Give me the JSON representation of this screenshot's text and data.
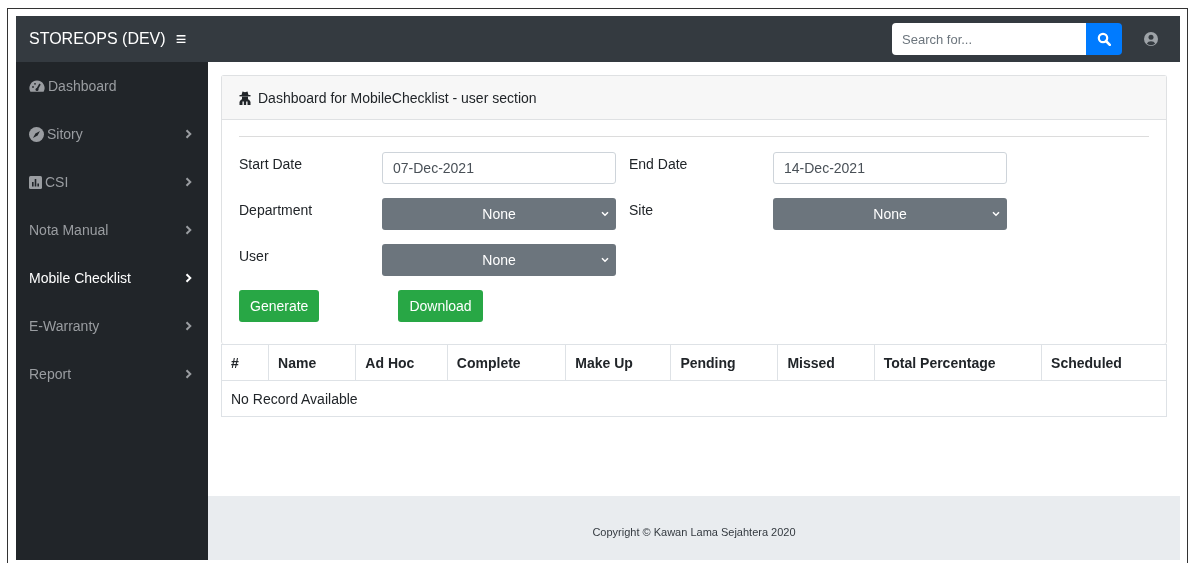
{
  "header": {
    "brand": "STOREOPS (DEV)",
    "menu_icon": "≡",
    "search": {
      "placeholder": "Search for..."
    }
  },
  "sidebar": {
    "items": [
      {
        "label": "Dashboard",
        "has_icon": true,
        "has_submenu": false,
        "selected": false
      },
      {
        "label": "Sitory",
        "has_icon": true,
        "has_submenu": true,
        "selected": false
      },
      {
        "label": "CSI",
        "has_icon": true,
        "has_submenu": true,
        "selected": false
      },
      {
        "label": "Nota Manual",
        "has_icon": false,
        "has_submenu": true,
        "selected": false
      },
      {
        "label": "Mobile Checklist",
        "has_icon": false,
        "has_submenu": true,
        "selected": true
      },
      {
        "label": "E-Warranty",
        "has_icon": false,
        "has_submenu": true,
        "selected": false
      },
      {
        "label": "Report",
        "has_icon": false,
        "has_submenu": true,
        "selected": false
      }
    ]
  },
  "card": {
    "title": "Dashboard for MobileChecklist - user section",
    "fields": [
      {
        "kind": "date",
        "label": "Start Date",
        "value": "07-Dec-2021"
      },
      {
        "kind": "date",
        "label": "End Date",
        "value": "14-Dec-2021"
      },
      {
        "kind": "select",
        "label": "Department",
        "value": "None"
      },
      {
        "kind": "select",
        "label": "Site",
        "value": "None"
      },
      {
        "kind": "select",
        "label": "User",
        "value": "None"
      }
    ],
    "buttons": [
      "Generate",
      "Download"
    ]
  },
  "table": {
    "columns": [
      "#",
      "Name",
      "Ad Hoc",
      "Complete",
      "Make Up",
      "Pending",
      "Missed",
      "Total Percentage",
      "Scheduled"
    ],
    "empty_message": "No Record Available"
  },
  "footer": "Copyright © Kawan Lama Sejahtera 2020"
}
